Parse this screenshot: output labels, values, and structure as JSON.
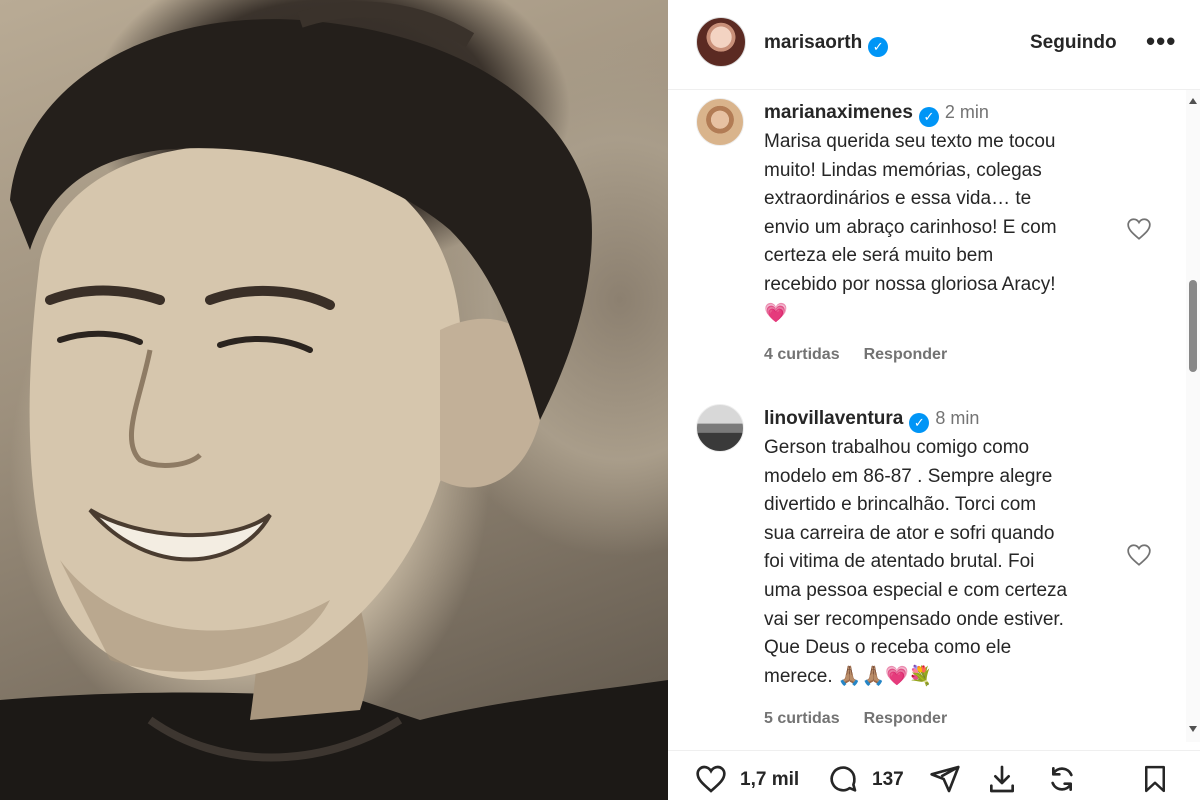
{
  "post": {
    "owner": {
      "username": "marisaorth",
      "verified": true,
      "follow_label": "Seguindo",
      "more_label": "•••"
    }
  },
  "comments": [
    {
      "username": "marianaximenes",
      "verified": true,
      "time": "2 min",
      "lines": [
        "Marisa querida seu texto me tocou",
        "muito! Lindas memórias, colegas",
        "extraordinários e essa vida… te",
        "envio um abraço carinhoso! E com",
        "certeza ele será muito bem",
        "recebido por nossa gloriosa Aracy!"
      ],
      "emoji": "💗",
      "likes": "4 curtidas",
      "reply_label": "Responder"
    },
    {
      "username": "linovillaventura",
      "verified": true,
      "time": "8 min",
      "lines": [
        "Gerson trabalhou comigo como",
        "modelo em 86-87 . Sempre alegre",
        "divertido e brincalhão. Torci com",
        "sua carreira de ator e sofri quando",
        "foi vitima de atentado brutal. Foi",
        "uma pessoa especial e com certeza",
        "vai ser recompensado onde estiver.",
        "Que Deus o receba como ele"
      ],
      "last_line": "merece.",
      "emoji": "🙏🏽🙏🏽💗💐",
      "likes": "5 curtidas",
      "reply_label": "Responder"
    }
  ],
  "actions": {
    "likes_count": "1,7 mil",
    "comments_count": "137",
    "icons": [
      "heart-icon",
      "comment-icon",
      "share-icon",
      "download-icon",
      "repost-icon",
      "bookmark-icon"
    ]
  },
  "colors": {
    "verified": "#0095f6",
    "text": "#262626",
    "muted": "#737373",
    "emoji_heart": "#e8456b"
  }
}
